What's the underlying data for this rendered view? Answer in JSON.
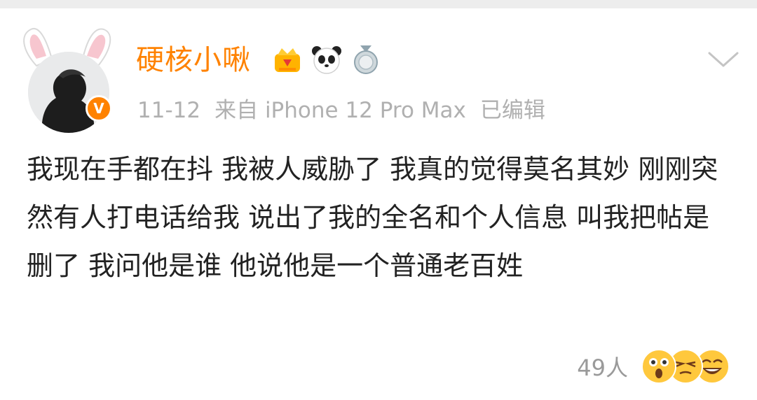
{
  "post": {
    "username": "硬核小啾",
    "badges": [
      "crown-badge-icon",
      "panda-badge-icon",
      "medal-badge-icon"
    ],
    "date": "11-12",
    "source": "来自 iPhone 12 Pro Max",
    "edited": "已编辑",
    "content": "我现在手都在抖 我被人威胁了 我真的觉得莫名其妙 刚刚突然有人打电话给我 说出了我的全名和个人信息 叫我把帖是删了 我问他是谁 他说他是一个普通老百姓",
    "reactions": {
      "count": "49人",
      "icons": [
        "shocked-face-icon",
        "squinting-face-icon",
        "laughing-face-icon"
      ]
    }
  },
  "colors": {
    "username": "#ff8200",
    "meta": "#b0b0b0",
    "text": "#222222",
    "verified": "#ff8200"
  }
}
